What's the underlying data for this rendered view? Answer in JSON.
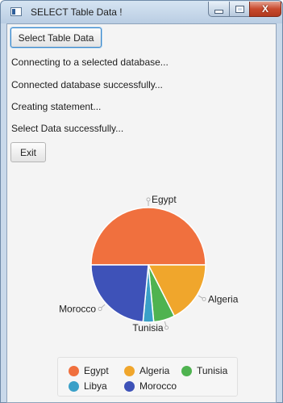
{
  "window": {
    "title": "SELECT Table Data !",
    "close_glyph": "X"
  },
  "controls": {
    "select_button": "Select Table Data",
    "exit_button": "Exit"
  },
  "status_lines": [
    "Connecting to a selected database...",
    "Connected database successfully...",
    "Creating statement...",
    "Select Data successfully..."
  ],
  "colors": {
    "Egypt": "#f0703e",
    "Algeria": "#f0a62c",
    "Tunisia": "#4fb350",
    "Libya": "#3aa0c8",
    "Morocco": "#3e52b8"
  },
  "chart_data": {
    "type": "pie",
    "categories": [
      "Egypt",
      "Algeria",
      "Tunisia",
      "Libya",
      "Morocco"
    ],
    "values": [
      50,
      17.5,
      6,
      3,
      23.5
    ],
    "legend": "bottom"
  }
}
